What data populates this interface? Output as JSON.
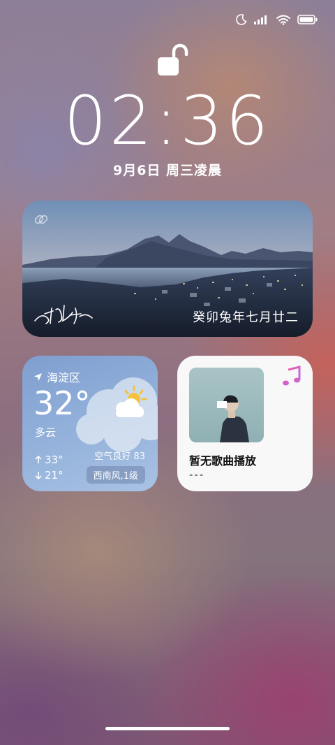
{
  "lockscreen": {
    "time": "02:36",
    "date": "9月6日 周三凌晨"
  },
  "photo_widget": {
    "lunar_date": "癸卯兔年七月廿二"
  },
  "weather": {
    "location": "海淀区",
    "temperature": "32°",
    "condition": "多云",
    "high": "33°",
    "low": "21°",
    "air_quality": "空气良好 83",
    "wind": "西南风,1级"
  },
  "music": {
    "title": "暂无歌曲播放",
    "artist": "---"
  },
  "colors": {
    "music_note_start": "#f05aa6",
    "music_note_end": "#b86cf0",
    "sun": "#f6c23e"
  },
  "icons": [
    "moon-icon",
    "signal-icon",
    "wifi-icon",
    "battery-icon",
    "unlock-icon",
    "link-icon",
    "location-arrow-icon",
    "partly-cloudy-icon",
    "arrow-up-icon",
    "arrow-down-icon",
    "music-note-icon"
  ]
}
